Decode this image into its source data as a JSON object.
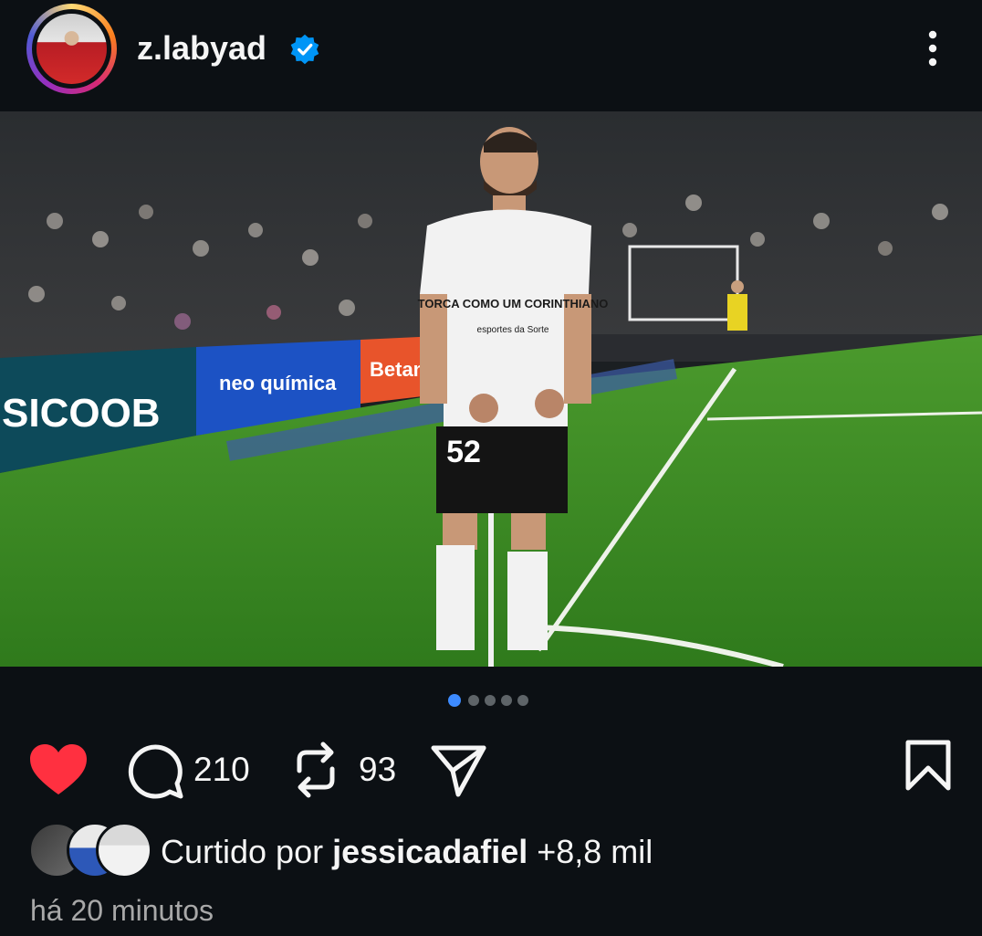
{
  "post": {
    "username": "z.labyad",
    "verified": true,
    "menu_icon": "more-vertical-icon",
    "image_alt": "Corinthians player number 52 celebrating near the corner flag in a full stadium",
    "image_texts": {
      "jersey_slogan": "TORCA COMO UM CORINTHIANO",
      "jersey_sponsor": "esportes da Sorte",
      "jersey_number": "52",
      "ad_1": "SICOOB",
      "ad_2": "neo química",
      "ad_3": "Betano"
    },
    "carousel": {
      "total": 5,
      "active_index": 0
    },
    "actions": {
      "liked": true,
      "comments": "210",
      "reposts": "93"
    },
    "likes": {
      "prefix": "Curtido por ",
      "user": "jessicadafiel",
      "suffix": " +8,8 mil"
    },
    "timestamp": "há 20 minutos"
  },
  "colors": {
    "background": "#0c1014",
    "like_red": "#ff3040",
    "verified_blue": "#0095f6",
    "active_dot": "#3d8bff"
  }
}
